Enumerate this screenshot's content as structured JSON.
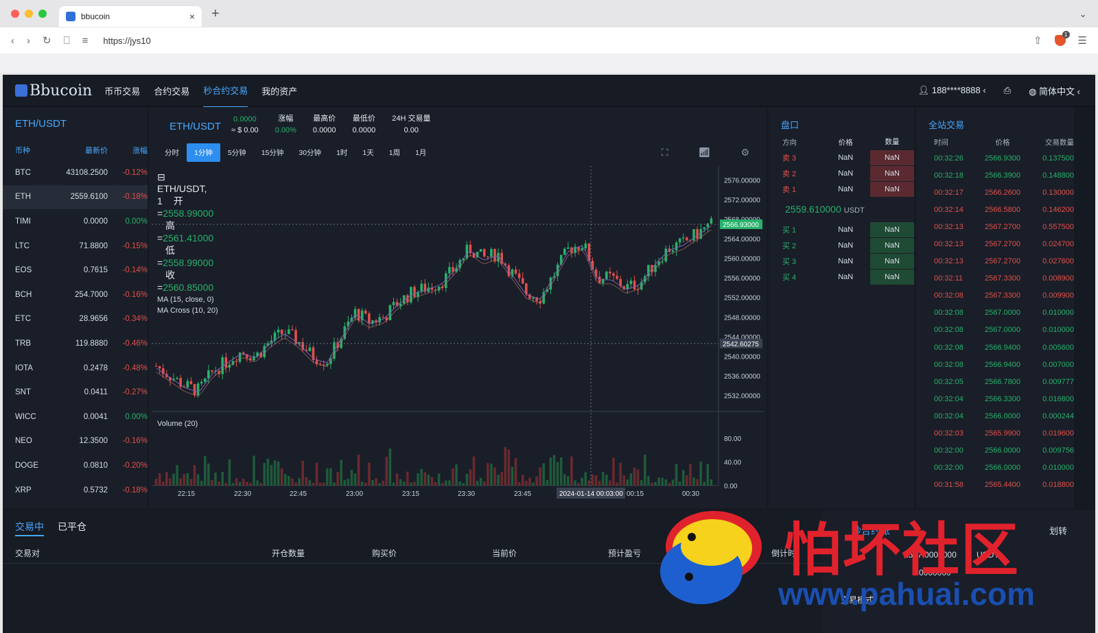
{
  "browser": {
    "tab_title": "bbucoin",
    "url": "https://jys10",
    "shield_badge": "1"
  },
  "nav": {
    "logo": "Bbucoin",
    "items": [
      "币币交易",
      "合约交易",
      "秒合约交易",
      "我的资产"
    ],
    "active": "秒合约交易",
    "user": "188****8888",
    "language": "简体中文"
  },
  "market_list": {
    "pair": "ETH/USDT",
    "headers": [
      "币种",
      "最新价",
      "涨幅"
    ],
    "rows": [
      {
        "coin": "BTC",
        "price": "43108.2500",
        "change": "-0.12%"
      },
      {
        "coin": "ETH",
        "price": "2559.6100",
        "change": "-0.18%"
      },
      {
        "coin": "TIMI",
        "price": "0.0000",
        "change": "0.00%"
      },
      {
        "coin": "LTC",
        "price": "71.8800",
        "change": "-0.15%"
      },
      {
        "coin": "EOS",
        "price": "0.7615",
        "change": "-0.14%"
      },
      {
        "coin": "BCH",
        "price": "254.7000",
        "change": "-0.16%"
      },
      {
        "coin": "ETC",
        "price": "28.9656",
        "change": "-0.34%"
      },
      {
        "coin": "TRB",
        "price": "119.8880",
        "change": "-0.46%"
      },
      {
        "coin": "IOTA",
        "price": "0.2478",
        "change": "-0.48%"
      },
      {
        "coin": "SNT",
        "price": "0.0411",
        "change": "-0.27%"
      },
      {
        "coin": "WICC",
        "price": "0.0041",
        "change": "0.00%"
      },
      {
        "coin": "NEO",
        "price": "12.3500",
        "change": "-0.16%"
      },
      {
        "coin": "DOGE",
        "price": "0.0810",
        "change": "-0.20%"
      },
      {
        "coin": "XRP",
        "price": "0.5732",
        "change": "-0.18%"
      }
    ]
  },
  "ticker": {
    "symbol": "ETH/USDT",
    "price": "0.0000",
    "price_fiat": "≈ $ 0.00",
    "change_label": "涨幅",
    "change": "0.00%",
    "high_label": "最高价",
    "high": "0.0000",
    "low_label": "最低价",
    "low": "0.0000",
    "vol_label": "24H 交易量",
    "vol": "0.00"
  },
  "intervals": [
    "分时",
    "1分钟",
    "5分钟",
    "15分钟",
    "30分钟",
    "1时",
    "1天",
    "1周",
    "1月"
  ],
  "active_interval": "1分钟",
  "chart_legend": {
    "title": "ETH/USDT, 1",
    "open_label": "开=",
    "open": "2558.99000",
    "high_label": "高=",
    "high": "2561.41000",
    "low_label": "低=",
    "low": "2558.99000",
    "close_label": "收=",
    "close": "2560.85000",
    "ma": "MA (15, close, 0)",
    "ma_cross": "MA Cross (10, 20)",
    "volume": "Volume (20)"
  },
  "chart_data": {
    "type": "candlestick",
    "price_ticks": [
      "2576.00000",
      "2572.00000",
      "2568.00000",
      "2564.00000",
      "2560.00000",
      "2556.00000",
      "2552.00000",
      "2548.00000",
      "2544.00000",
      "2540.00000",
      "2536.00000",
      "2532.00000"
    ],
    "ylim": [
      2529,
      2578
    ],
    "last_price_label": "2566.93000",
    "crosshair_price_label": "2542.60275",
    "volume_ticks": [
      "80.00",
      "40.00",
      "0.00"
    ],
    "volume_ylim": [
      0,
      100
    ],
    "time_ticks": [
      "22:15",
      "22:30",
      "22:45",
      "23:00",
      "23:15",
      "23:30",
      "23:45",
      "00:15",
      "00:30"
    ],
    "crosshair_time_label": "2024-01-14 00:03:00",
    "close_path": [
      2538,
      2536,
      2534,
      2533,
      2537,
      2539,
      2541,
      2540,
      2543,
      2545,
      2543,
      2540,
      2539,
      2544,
      2549,
      2547,
      2548,
      2551,
      2553,
      2554,
      2555,
      2558,
      2562,
      2560,
      2561,
      2557,
      2553,
      2552,
      2557,
      2562,
      2563,
      2556,
      2556,
      2554,
      2555,
      2559,
      2562,
      2563,
      2565,
      2567
    ]
  },
  "order_book": {
    "title": "盘口",
    "headers": [
      "方向",
      "价格",
      "数量"
    ],
    "asks": [
      {
        "side": "卖 3",
        "price": "NaN",
        "qty": "NaN"
      },
      {
        "side": "卖 2",
        "price": "NaN",
        "qty": "NaN"
      },
      {
        "side": "卖 1",
        "price": "NaN",
        "qty": "NaN"
      }
    ],
    "last_price": "2559.610000",
    "last_unit": "USDT",
    "bids": [
      {
        "side": "买 1",
        "price": "NaN",
        "qty": "NaN"
      },
      {
        "side": "买 2",
        "price": "NaN",
        "qty": "NaN"
      },
      {
        "side": "买 3",
        "price": "NaN",
        "qty": "NaN"
      },
      {
        "side": "买 4",
        "price": "NaN",
        "qty": "NaN"
      }
    ]
  },
  "trades": {
    "title": "全站交易",
    "headers": [
      "时间",
      "价格",
      "交易数量"
    ],
    "rows": [
      {
        "time": "00:32:26",
        "price": "2566.9300",
        "qty": "0.137500",
        "dir": "g"
      },
      {
        "time": "00:32:18",
        "price": "2566.3900",
        "qty": "0.148800",
        "dir": "g"
      },
      {
        "time": "00:32:17",
        "price": "2566.2600",
        "qty": "0.130000",
        "dir": "r"
      },
      {
        "time": "00:32:14",
        "price": "2566.5800",
        "qty": "0.146200",
        "dir": "r"
      },
      {
        "time": "00:32:13",
        "price": "2567.2700",
        "qty": "0.557500",
        "dir": "r"
      },
      {
        "time": "00:32:13",
        "price": "2567.2700",
        "qty": "0.024700",
        "dir": "r"
      },
      {
        "time": "00:32:13",
        "price": "2567.2700",
        "qty": "0.027600",
        "dir": "r"
      },
      {
        "time": "00:32:11",
        "price": "2567.3300",
        "qty": "0.008900",
        "dir": "r"
      },
      {
        "time": "00:32:08",
        "price": "2567.3300",
        "qty": "0.009900",
        "dir": "r"
      },
      {
        "time": "00:32:08",
        "price": "2567.0000",
        "qty": "0.010000",
        "dir": "g"
      },
      {
        "time": "00:32:08",
        "price": "2567.0000",
        "qty": "0.010000",
        "dir": "g"
      },
      {
        "time": "00:32:08",
        "price": "2566.9400",
        "qty": "0.005600",
        "dir": "g"
      },
      {
        "time": "00:32:08",
        "price": "2566.9400",
        "qty": "0.007000",
        "dir": "g"
      },
      {
        "time": "00:32:05",
        "price": "2566.7800",
        "qty": "0.009777",
        "dir": "g"
      },
      {
        "time": "00:32:04",
        "price": "2566.3300",
        "qty": "0.016800",
        "dir": "g"
      },
      {
        "time": "00:32:04",
        "price": "2566.0000",
        "qty": "0.000244",
        "dir": "g"
      },
      {
        "time": "00:32:03",
        "price": "2565.9900",
        "qty": "0.019600",
        "dir": "r"
      },
      {
        "time": "00:32:00",
        "price": "2566.0000",
        "qty": "0.009756",
        "dir": "g"
      },
      {
        "time": "00:32:00",
        "price": "2566.0000",
        "qty": "0.010000",
        "dir": "g"
      },
      {
        "time": "00:31:58",
        "price": "2565.4400",
        "qty": "0.018800",
        "dir": "r"
      }
    ]
  },
  "positions": {
    "tab_open": "交易中",
    "tab_closed": "已平仓",
    "columns": [
      "交易对",
      "开仓数量",
      "购买价",
      "当前价",
      "预计盈亏",
      "倒计时"
    ]
  },
  "account": {
    "title": "秒合约账",
    "transfer": "划转",
    "balance": "2567.0000000",
    "unit": "USDT",
    "frozen": "0.0000000",
    "mode": "交易模式"
  },
  "watermark": {
    "cn": "怕坏社区",
    "url": "www.pahuai.com"
  },
  "colors": {
    "accent": "#4aa8ff",
    "up": "#27b26c",
    "down": "#e2504b",
    "bg": "#151a22"
  }
}
